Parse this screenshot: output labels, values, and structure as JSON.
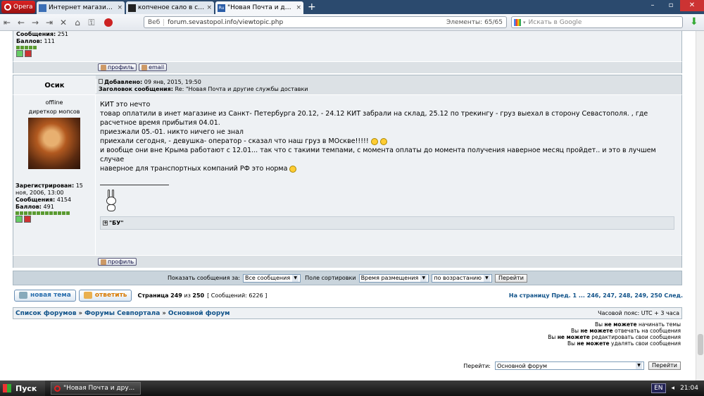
{
  "browser": {
    "opera_label": "Opera",
    "tabs": [
      {
        "label": "Интернет магазин Nago...",
        "favicon_color": "#3b6fb6"
      },
      {
        "label": "копченое сало в супер...",
        "favicon_color": "#222222"
      },
      {
        "label": "\"Новая Почта и другие ...",
        "favicon_color": "#2a5da8",
        "favicon_text": "Ru",
        "active": true
      }
    ],
    "new_tab": "+",
    "web_label": "Веб",
    "url": "forum.sevastopol.info/viewtopic.php",
    "elements_label": "Элементы:",
    "elements_count": "65/65",
    "search_placeholder": "Искать в Google"
  },
  "prev_post": {
    "posts_label": "Сообщения:",
    "posts_value": "251",
    "points_label": "Баллов:",
    "points_value": "111",
    "profile_btn": "профиль",
    "email_btn": "email"
  },
  "post": {
    "author": "Осик",
    "status": "offline",
    "rank": "диреткор мопсов",
    "registered_label": "Зарегистрирован:",
    "registered_value": "15 ноя, 2006, 13:00",
    "posts_label": "Сообщения:",
    "posts_value": "4154",
    "points_label": "Баллов:",
    "points_value": "491",
    "added_label": "Добавлено:",
    "added_value": "09 янв, 2015, 19:50",
    "subject_label": "Заголовок сообщения:",
    "subject_value": "Re: \"Новая Почта и другие службы доставки",
    "lines": [
      "КИТ это нечто",
      "товар оплатили в инет магазине из Санкт- Петербурга 20.12, - 24.12 КИТ забрали на склад, 25.12 по трекингу - груз выехал в сторону Севастополя. , где расчетное время прибытия 04.01.",
      "приезжали 05.-01. никто ничего не знал",
      "приехали сегодня, - девушка- оператор - сказал что наш груз в МОскве!!!!!",
      "и вообще они вне Крыма работают с 12.01... так что с такими темпами, с момента оплаты до момента получения наверное месяц пройдет.. и это в лучшем случае",
      "наверное для транспортных компаний РФ это норма"
    ],
    "spoiler_label": "\"БУ\"",
    "profile_btn": "профиль"
  },
  "sortbar": {
    "show_label": "Показать сообщения за:",
    "show_value": "Все сообщения",
    "sort_label": "Поле сортировки",
    "sort_value": "Время размещения",
    "order_value": "по возрастанию",
    "go_btn": "Перейти"
  },
  "pagination": {
    "new_topic": "новая тема",
    "reply": "ответить",
    "page_word": "Страница",
    "page_current": "249",
    "page_of": "из",
    "page_total": "250",
    "messages_info": "[ Сообщений: 6226 ]",
    "goto_label": "На страницу",
    "prev": "Пред.",
    "pages": "1 ... 246, 247, 248, 249, 250",
    "next": "След."
  },
  "breadcrumb": {
    "items": [
      "Список форумов",
      "Форумы Севпортала",
      "Основной форум"
    ],
    "sep": "»",
    "timezone": "Часовой пояс: UTC + 3 часа"
  },
  "permissions": [
    {
      "pre": "Вы",
      "bold": "не можете",
      "post": "начинать темы"
    },
    {
      "pre": "Вы",
      "bold": "не можете",
      "post": "отвечать на сообщения"
    },
    {
      "pre": "Вы",
      "bold": "не можете",
      "post": "редактировать свои сообщения"
    },
    {
      "pre": "Вы",
      "bold": "не можете",
      "post": "удалять свои сообщения"
    }
  ],
  "jump": {
    "label": "Перейти:",
    "value": "Основной форум",
    "btn": "Перейти"
  },
  "taskbar": {
    "start": "Пуск",
    "task": "\"Новая Почта и дру...",
    "lang": "EN",
    "time": "21:04"
  }
}
